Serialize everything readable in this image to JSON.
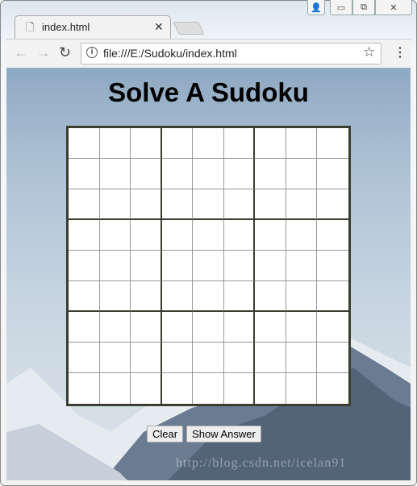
{
  "browser": {
    "tab_title": "index.html",
    "url": "file:///E:/Sudoku/index.html",
    "icons": [
      "page-icon",
      "close-icon",
      "back-icon",
      "forward-icon",
      "reload-icon",
      "info-icon",
      "star-icon",
      "menu-icon",
      "user-icon",
      "minimize-icon",
      "maximize-icon",
      "window-close-icon"
    ]
  },
  "page": {
    "title": "Solve A Sudoku",
    "grid": [
      [
        "",
        "",
        "",
        "",
        "",
        "",
        "",
        "",
        ""
      ],
      [
        "",
        "",
        "",
        "",
        "",
        "",
        "",
        "",
        ""
      ],
      [
        "",
        "",
        "",
        "",
        "",
        "",
        "",
        "",
        ""
      ],
      [
        "",
        "",
        "",
        "",
        "",
        "",
        "",
        "",
        ""
      ],
      [
        "",
        "",
        "",
        "",
        "",
        "",
        "",
        "",
        ""
      ],
      [
        "",
        "",
        "",
        "",
        "",
        "",
        "",
        "",
        ""
      ],
      [
        "",
        "",
        "",
        "",
        "",
        "",
        "",
        "",
        ""
      ],
      [
        "",
        "",
        "",
        "",
        "",
        "",
        "",
        "",
        ""
      ],
      [
        "",
        "",
        "",
        "",
        "",
        "",
        "",
        "",
        ""
      ]
    ],
    "clear_label": "Clear",
    "show_answer_label": "Show Answer",
    "watermark": "http://blog.csdn.net/icelan91"
  }
}
